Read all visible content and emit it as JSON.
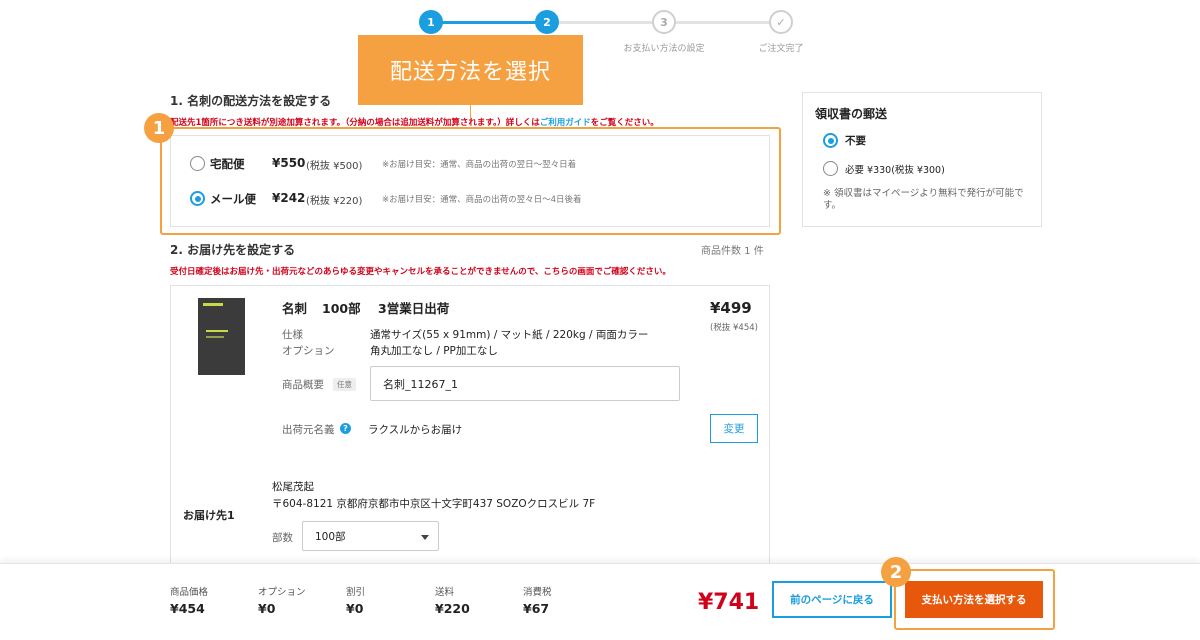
{
  "progress": {
    "steps": [
      {
        "number": "1",
        "label": ""
      },
      {
        "number": "2",
        "label": ""
      },
      {
        "number": "3",
        "label": "お支払い方法の設定"
      },
      {
        "number": "✓",
        "label": "ご注文完了"
      }
    ],
    "active_color": "#1b9ee0"
  },
  "callout": {
    "banner_text": "配送方法を選択",
    "badge_1": "1",
    "badge_2": "2",
    "color": "#f5a142"
  },
  "shipping": {
    "title": "1. 名刺の配送方法を設定する",
    "notice_main": "配送先1箇所につき送料が別途加算されます。（分納の場合は追加送料が加算されます。）詳しくは",
    "notice_link": "ご利用ガイド",
    "notice_end": "をご覧ください。",
    "options": [
      {
        "name": "宅配便",
        "price": "¥550",
        "tax": "(税抜 ¥500)",
        "note": "※お届け目安：通常、商品の出荷の翌日〜翌々日着",
        "selected": false
      },
      {
        "name": "メール便",
        "price": "¥242",
        "tax": "(税抜 ¥220)",
        "note": "※お届け目安：通常、商品の出荷の翌々日〜4日後着",
        "selected": true
      }
    ]
  },
  "delivery": {
    "title": "2. お届け先を設定する",
    "count": "商品件数 1 件",
    "warning": "受付日確定後はお届け先・出荷元などのあらゆる変更やキャンセルを承ることができませんので、こちらの画面でご確認ください。",
    "product": {
      "name": "名刺",
      "quantity": "100部",
      "ship_days": "3営業日出荷",
      "price": "¥499",
      "tax": "(税抜 ¥454)",
      "spec_label": "仕様",
      "spec_value": "通常サイズ(55 x 91mm) / マット紙 / 220kg / 両面カラー",
      "option_label": "オプション",
      "option_value": "角丸加工なし / PP加工なし",
      "summary_label": "商品概要",
      "summary_tag": "任意",
      "summary_value": "名刺_11267_1",
      "sender_label": "出荷元名義",
      "sender_value": "ラクスルからお届け",
      "change_label": "変更"
    },
    "destination": {
      "label": "お届け先1",
      "name": "松尾茂起",
      "address": "〒604-8121 京都府京都市中京区十文字町437 SOZOクロスビル 7F",
      "qty_label": "部数",
      "qty_value": "100部"
    }
  },
  "receipt": {
    "title": "領収書の郵送",
    "options": [
      {
        "label": "不要",
        "selected": true
      },
      {
        "label": "必要 ¥330(税抜 ¥300)",
        "selected": false
      }
    ],
    "note": "※ 領収書はマイページより無料で発行が可能です。"
  },
  "footer": {
    "items": [
      {
        "label": "商品価格",
        "value": "¥454"
      },
      {
        "label": "オプション",
        "value": "¥0"
      },
      {
        "label": "割引",
        "value": "¥0"
      },
      {
        "label": "送料",
        "value": "¥220"
      },
      {
        "label": "消費税",
        "value": "¥67"
      }
    ],
    "total": "¥741",
    "back_label": "前のページに戻る",
    "next_label": "支払い方法を選択する"
  }
}
